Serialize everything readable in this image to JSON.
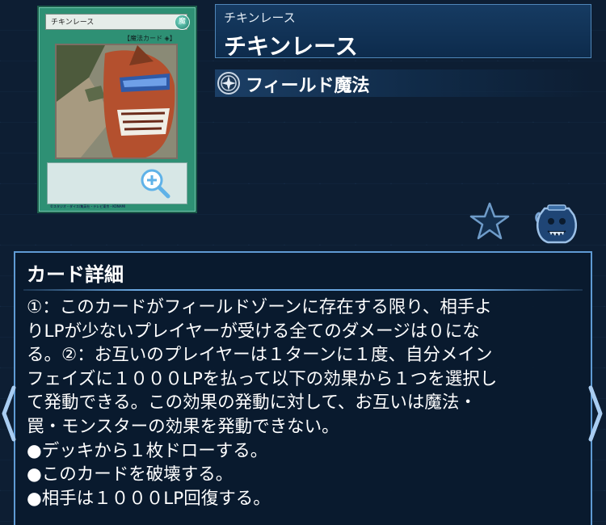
{
  "card": {
    "name_on_card": "チキンレース",
    "attribute_glyph": "魔",
    "type_line": "【魔法カード",
    "type_glyph": "◈",
    "type_close": "】",
    "copyright": "©スタジオ・ダイス/集英社・テレビ東京・KONAMI"
  },
  "header": {
    "name_reading": "チキンレース",
    "name": "チキンレース",
    "card_type": "フィールド魔法"
  },
  "detail": {
    "title": "カード詳細",
    "lines": [
      "①：このカードがフィールドゾーンに存在する限り、相手よ",
      "りLPが少ないプレイヤーが受ける全てのダメージは０にな",
      "る。②：お互いのプレイヤーは１ターンに１度、自分メイン",
      "フェイズに１０００LPを払って以下の効果から１つを選択し",
      "て発動できる。この効果の発動に対して、お互いは魔法・",
      "罠・モンスターの効果を発動できない。",
      "●デッキから１枚ドローする。",
      "●このカードを破壊する。",
      "●相手は１０００LP回復する。"
    ]
  },
  "colors": {
    "background": "#0d1e33",
    "panel_border": "#5f9bd4",
    "spell_card_green": "#2e9074",
    "text": "#ffffff"
  },
  "icons": {
    "zoom": "zoom-in-icon",
    "spell_type": "field-spell-icon",
    "favorite": "star-icon",
    "deck": "deck-pot-icon",
    "nav_prev": "chevron-left-icon",
    "nav_next": "chevron-right-icon"
  }
}
